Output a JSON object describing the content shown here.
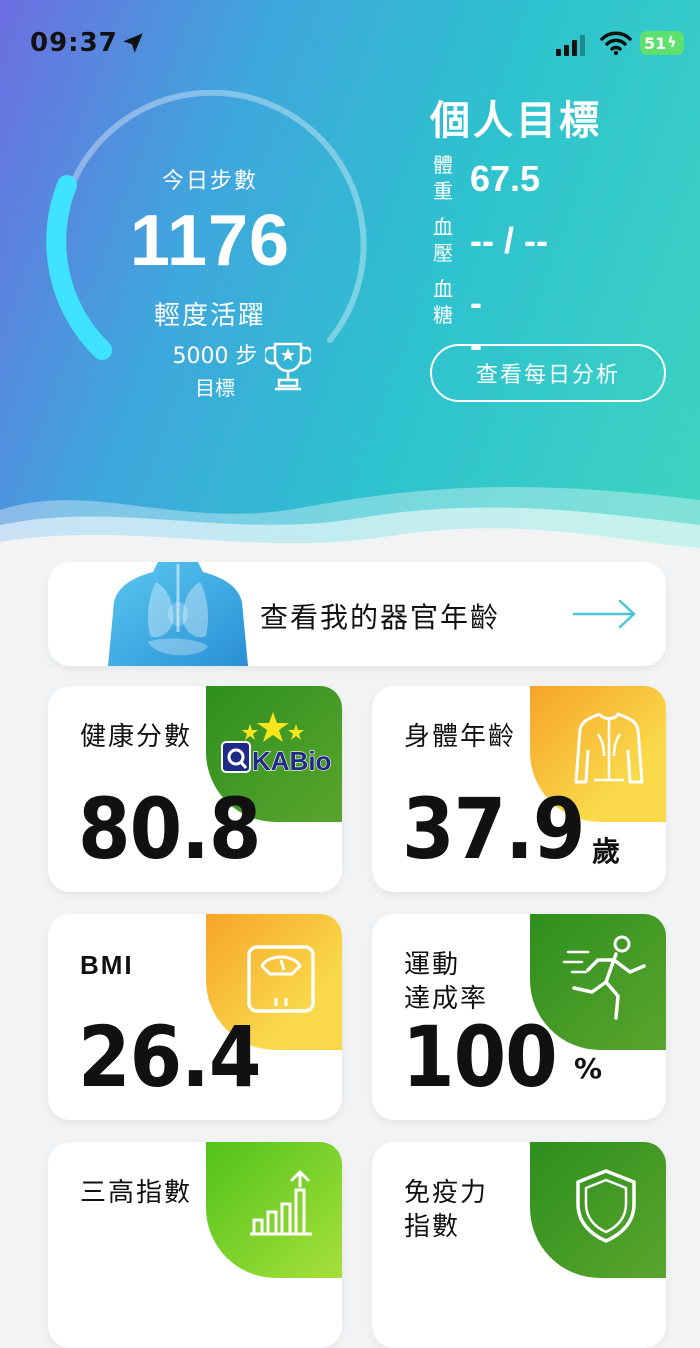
{
  "status_bar": {
    "time": "09:37",
    "battery": "51"
  },
  "steps": {
    "title": "今日步數",
    "value": "1176",
    "activity_level": "輕度活躍",
    "goal_steps": "5000 步",
    "goal_label": "目標",
    "progress": 0.2352
  },
  "personal_goals": {
    "title": "個人目標",
    "rows": [
      {
        "label": "體重",
        "value": "67.5"
      },
      {
        "label": "血壓",
        "value": "-- / --"
      },
      {
        "label": "血糖",
        "value": "--"
      }
    ],
    "daily_analysis_button": "查看每日分析"
  },
  "organ_age": {
    "label": "查看我的器官年齡"
  },
  "cards": [
    {
      "title": "健康分數",
      "value": "80.8",
      "unit": "",
      "logo_text": "KABio",
      "icon": "kabio-logo"
    },
    {
      "title": "身體年齡",
      "value": "37.9",
      "unit": "歲",
      "icon": "body-icon"
    },
    {
      "title": "BMI",
      "value": "26.4",
      "unit": "",
      "icon": "scale-icon"
    },
    {
      "title": "運動\n達成率",
      "title_line1": "運動",
      "title_line2": "達成率",
      "value": "100",
      "unit": "%",
      "icon": "runner-icon"
    },
    {
      "title": "三高指數",
      "value": "",
      "unit": "",
      "icon": "chart-up-icon"
    },
    {
      "title": "免疫力\n指數",
      "title_line1": "免疫力",
      "title_line2": "指數",
      "value": "",
      "unit": "",
      "icon": "shield-icon"
    }
  ],
  "colors": {
    "accent_cyan": "#3fd8ff",
    "card_green": "#3e9a22",
    "card_yellow": "#f8c23a",
    "card_lime": "#7fd02a"
  }
}
